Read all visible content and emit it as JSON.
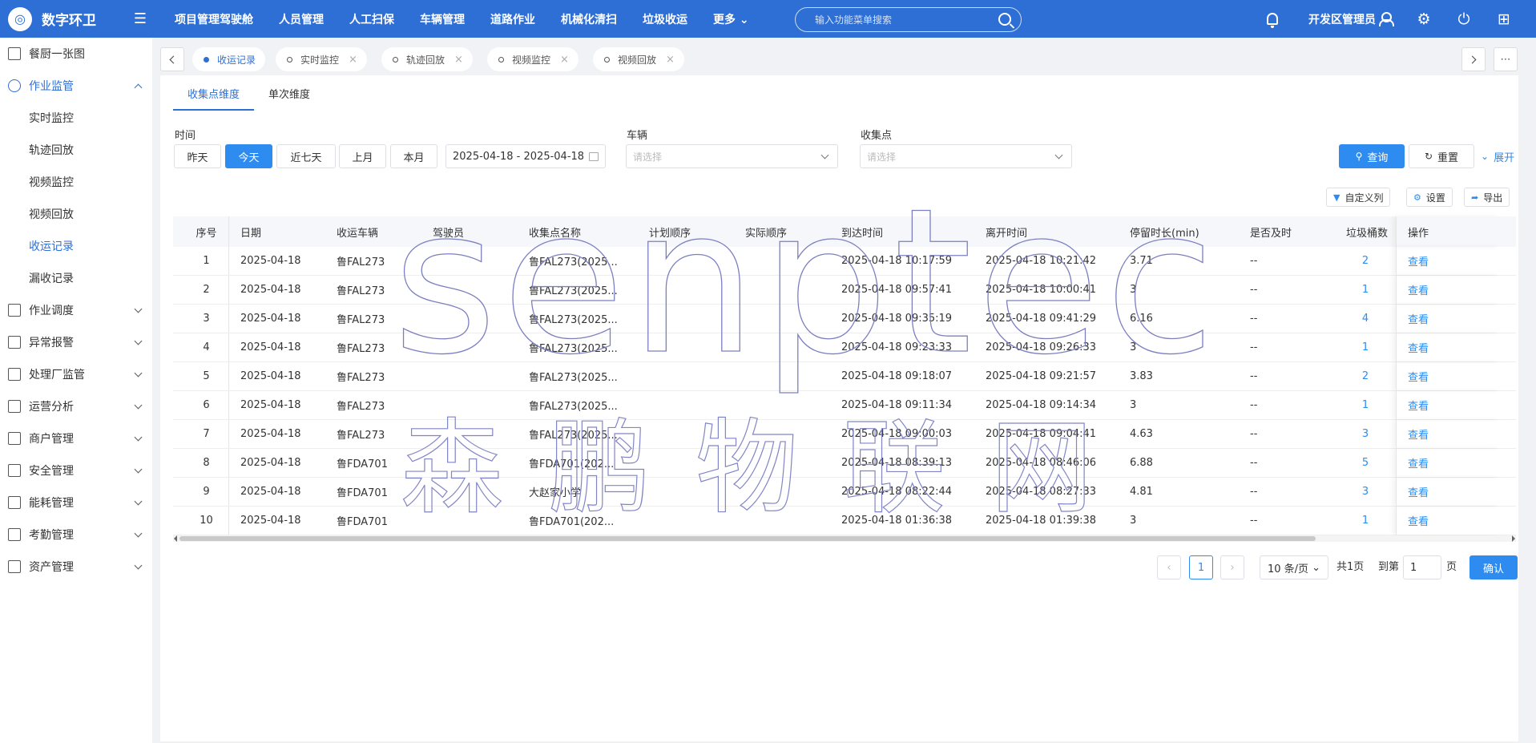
{
  "app": {
    "logo_text": "数字环卫"
  },
  "topnav": [
    "项目管理驾驶舱",
    "人员管理",
    "人工扫保",
    "车辆管理",
    "道路作业",
    "机械化清扫",
    "垃圾收运",
    "更多"
  ],
  "search": {
    "placeholder": "输入功能菜单搜索"
  },
  "user": {
    "name": "开发区管理员"
  },
  "sidebar": [
    {
      "label": "餐厨一张图"
    },
    {
      "label": "作业监管",
      "expanded": true,
      "children": [
        "实时监控",
        "轨迹回放",
        "视频监控",
        "视频回放",
        "收运记录",
        "漏收记录"
      ],
      "selected": "收运记录"
    },
    {
      "label": "作业调度"
    },
    {
      "label": "异常报警"
    },
    {
      "label": "处理厂监管"
    },
    {
      "label": "运营分析"
    },
    {
      "label": "商户管理"
    },
    {
      "label": "安全管理"
    },
    {
      "label": "能耗管理"
    },
    {
      "label": "考勤管理"
    },
    {
      "label": "资产管理"
    }
  ],
  "tabs": [
    {
      "label": "收运记录",
      "active": true
    },
    {
      "label": "实时监控",
      "close": "×"
    },
    {
      "label": "轨迹回放",
      "close": "×"
    },
    {
      "label": "视频监控",
      "close": "×"
    },
    {
      "label": "视频回放",
      "close": "×"
    }
  ],
  "subtabs": [
    "收集点维度",
    "单次维度"
  ],
  "filters": {
    "time_label": "时间",
    "quick": [
      "昨天",
      "今天",
      "近七天",
      "上月",
      "本月"
    ],
    "quick_active": "今天",
    "date_range": "2025-04-18 - 2025-04-18",
    "vehicle_label": "车辆",
    "vehicle_placeholder": "请选择",
    "point_label": "收集点",
    "point_placeholder": "请选择",
    "query": "查询",
    "reset": "重置",
    "expand": "展开"
  },
  "toolbar": {
    "custom": "自定义列",
    "settings": "设置",
    "export": "导出"
  },
  "table": {
    "columns": [
      "序号",
      "日期",
      "收运车辆",
      "驾驶员",
      "收集点名称",
      "计划顺序",
      "实际顺序",
      "到达时间",
      "离开时间",
      "停留时长(min)",
      "是否及时",
      "垃圾桶数",
      "操作"
    ],
    "rows": [
      [
        "1",
        "2025-04-18",
        "鲁FAL273",
        "",
        "鲁FAL273(2025...",
        "",
        "",
        "2025-04-18 10:17:59",
        "2025-04-18 10:21:42",
        "3.71",
        "--",
        "2",
        "查看"
      ],
      [
        "2",
        "2025-04-18",
        "鲁FAL273",
        "",
        "鲁FAL273(2025...",
        "",
        "",
        "2025-04-18 09:57:41",
        "2025-04-18 10:00:41",
        "3",
        "--",
        "1",
        "查看"
      ],
      [
        "3",
        "2025-04-18",
        "鲁FAL273",
        "",
        "鲁FAL273(2025...",
        "",
        "",
        "2025-04-18 09:35:19",
        "2025-04-18 09:41:29",
        "6.16",
        "--",
        "4",
        "查看"
      ],
      [
        "4",
        "2025-04-18",
        "鲁FAL273",
        "",
        "鲁FAL273(2025...",
        "",
        "",
        "2025-04-18 09:23:33",
        "2025-04-18 09:26:33",
        "3",
        "--",
        "1",
        "查看"
      ],
      [
        "5",
        "2025-04-18",
        "鲁FAL273",
        "",
        "鲁FAL273(2025...",
        "",
        "",
        "2025-04-18 09:18:07",
        "2025-04-18 09:21:57",
        "3.83",
        "--",
        "2",
        "查看"
      ],
      [
        "6",
        "2025-04-18",
        "鲁FAL273",
        "",
        "鲁FAL273(2025...",
        "",
        "",
        "2025-04-18 09:11:34",
        "2025-04-18 09:14:34",
        "3",
        "--",
        "1",
        "查看"
      ],
      [
        "7",
        "2025-04-18",
        "鲁FAL273",
        "",
        "鲁FAL273(2025...",
        "",
        "",
        "2025-04-18 09:00:03",
        "2025-04-18 09:04:41",
        "4.63",
        "--",
        "3",
        "查看"
      ],
      [
        "8",
        "2025-04-18",
        "鲁FDA701",
        "",
        "鲁FDA701(202...",
        "",
        "",
        "2025-04-18 08:39:13",
        "2025-04-18 08:46:06",
        "6.88",
        "--",
        "5",
        "查看"
      ],
      [
        "9",
        "2025-04-18",
        "鲁FDA701",
        "",
        "大赵家小学",
        "",
        "",
        "2025-04-18 08:22:44",
        "2025-04-18 08:27:33",
        "4.81",
        "--",
        "3",
        "查看"
      ],
      [
        "10",
        "2025-04-18",
        "鲁FDA701",
        "",
        "鲁FDA701(202...",
        "",
        "",
        "2025-04-18 01:36:38",
        "2025-04-18 01:39:38",
        "3",
        "--",
        "1",
        "查看"
      ]
    ]
  },
  "pagination": {
    "current": "1",
    "page_size": "10 条/页",
    "total": "共1页",
    "goto_prefix": "到第",
    "goto_value": "1",
    "goto_suffix": "页",
    "confirm": "确认"
  },
  "watermark": {
    "latin": "senptec",
    "cjk": "森鹏物联网"
  },
  "colors": {
    "header": "#2e6fd6",
    "primary": "#2e8cf0"
  }
}
